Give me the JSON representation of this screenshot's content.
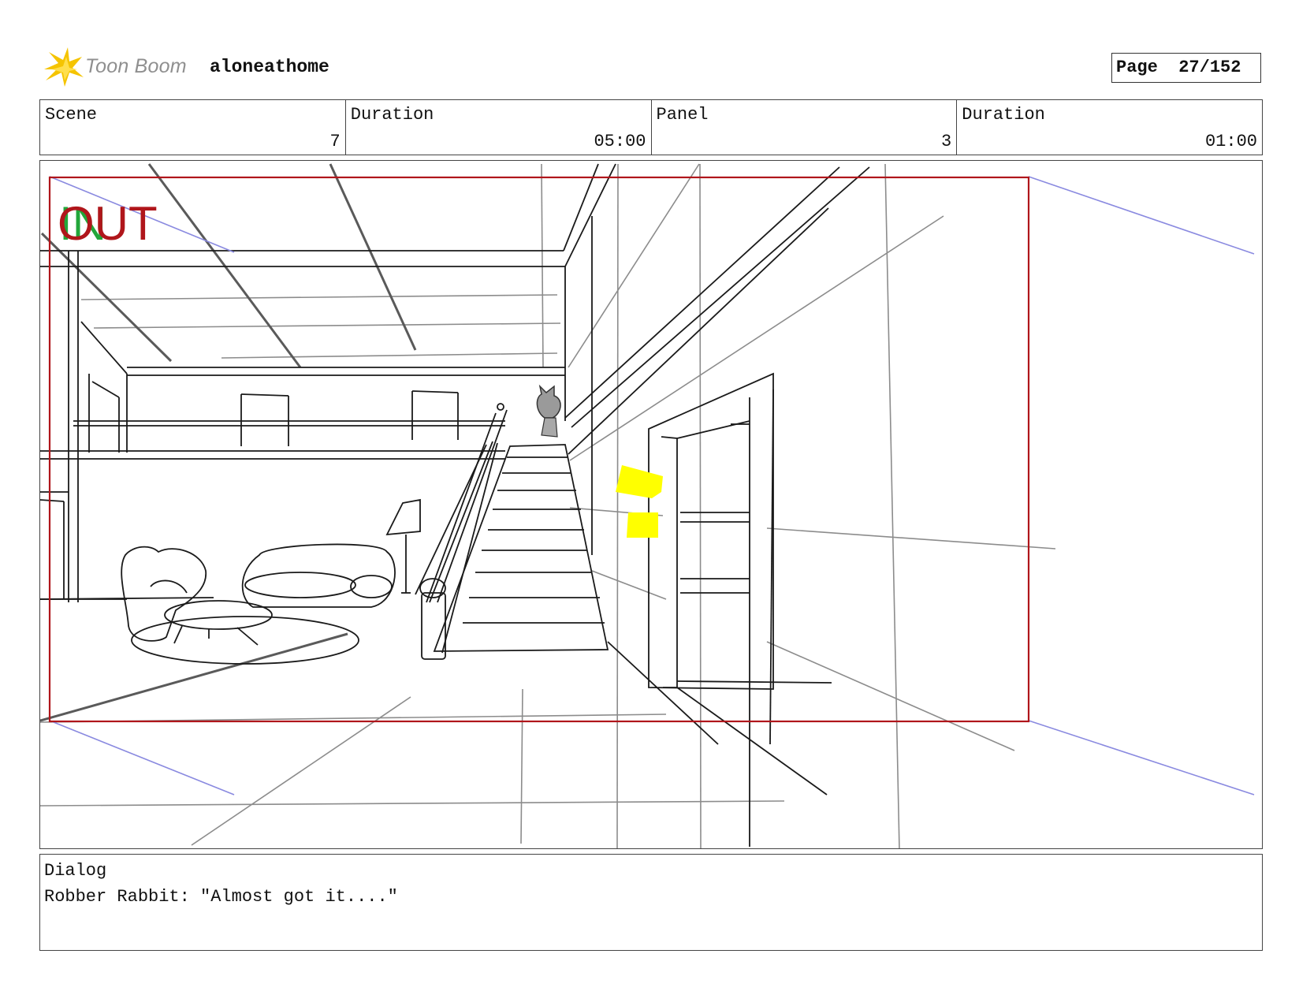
{
  "header": {
    "brand": "Toon Boom",
    "project": "aloneathome",
    "page_label": "Page",
    "page_number": "27/152"
  },
  "info": {
    "scene_label": "Scene",
    "scene_value": "7",
    "scene_duration_label": "Duration",
    "scene_duration_value": "05:00",
    "panel_label": "Panel",
    "panel_value": "3",
    "panel_duration_label": "Duration",
    "panel_duration_value": "01:00"
  },
  "panel": {
    "in_marker": "IN",
    "out_marker": "OUT",
    "frame_color": "#b0161b",
    "guide_color": "#8a8ae0",
    "highlight_color": "#ffff00"
  },
  "dialog": {
    "label": "Dialog",
    "text": "Robber Rabbit: \"Almost got it....\""
  }
}
